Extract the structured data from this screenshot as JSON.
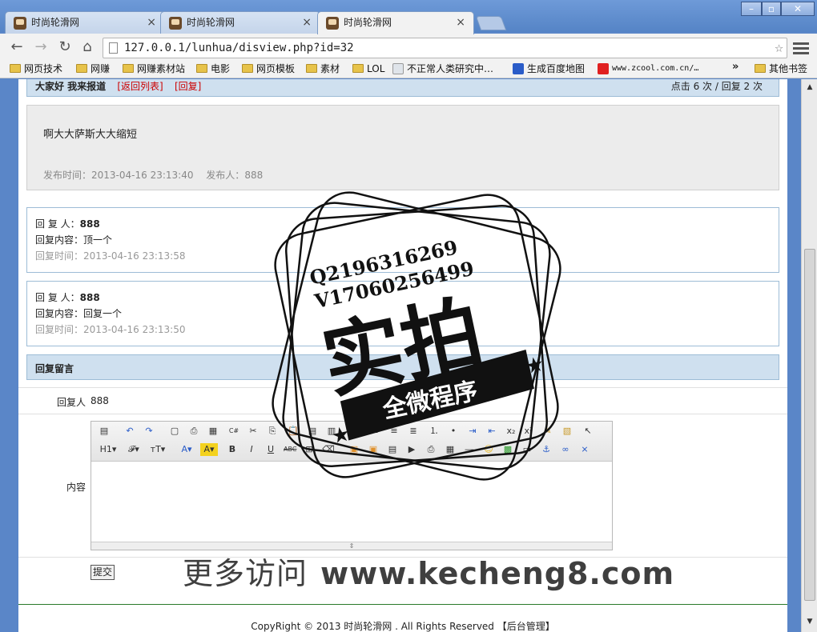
{
  "browser": {
    "tabs": [
      {
        "label": "时尚轮滑网"
      },
      {
        "label": "时尚轮滑网"
      },
      {
        "label": "时尚轮滑网"
      }
    ],
    "url": "127.0.0.1/lunhua/disview.php?id=32",
    "bookmarks": [
      {
        "label": "网页技术",
        "type": "folder"
      },
      {
        "label": "网赚",
        "type": "folder"
      },
      {
        "label": "网赚素材站",
        "type": "folder"
      },
      {
        "label": "电影",
        "type": "folder"
      },
      {
        "label": "网页模板",
        "type": "folder"
      },
      {
        "label": "素材",
        "type": "folder"
      },
      {
        "label": "LOL",
        "type": "folder"
      },
      {
        "label": "不正常人类研究中…",
        "type": "site"
      },
      {
        "label": "生成百度地图",
        "type": "site"
      },
      {
        "label": "www.zcool.com.cn/…",
        "type": "site"
      },
      {
        "label": "其他书签",
        "type": "folder"
      }
    ],
    "overflow": "»"
  },
  "post": {
    "title": "大家好 我来报道",
    "back_link": "[返回列表]",
    "reply_link": "[回复]",
    "stats": "点击 6 次 / 回复 2 次",
    "body": "啊大大萨斯大大缩短",
    "publish_time_label": "发布时间：",
    "publish_time": "2013-04-16 23:13:40",
    "author_label": "发布人：",
    "author": "888"
  },
  "replies": [
    {
      "who_label": "回 复 人：",
      "who": "888",
      "content_label": "回复内容：",
      "content": "顶一个",
      "time_label": "回复时间：",
      "time": "2013-04-16 23:13:58"
    },
    {
      "who_label": "回 复 人：",
      "who": "888",
      "content_label": "回复内容：",
      "content": "回复一个",
      "time_label": "回复时间：",
      "time": "2013-04-16 23:13:50"
    }
  ],
  "form": {
    "heading": "回复留言",
    "replier_label": "回复人",
    "replier_value": "888",
    "content_label": "内容",
    "submit_label": "提交"
  },
  "footer": "CopyRight © 2013 时尚轮滑网 . All Rights Reserved 【后台管理】",
  "watermark": {
    "line1": "Q2196316269",
    "line2": "V17060256499",
    "big": "实拍",
    "banner": "全微程序",
    "bottom_cn": "更多访问",
    "bottom_url": "www.kecheng8.com"
  }
}
